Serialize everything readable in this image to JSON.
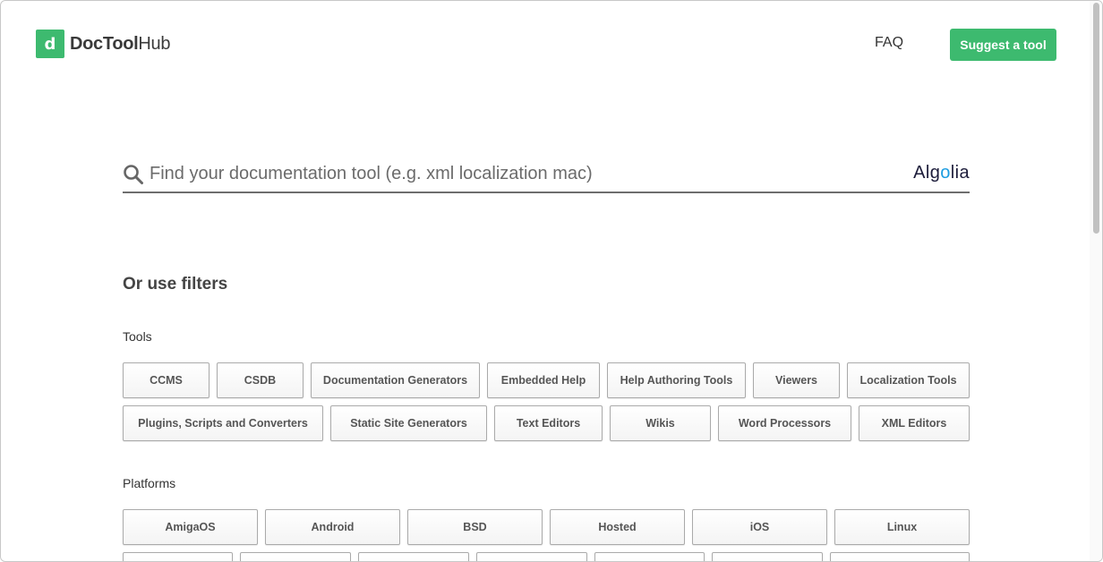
{
  "header": {
    "logo_letter": "d",
    "logo_bold": "DocTool",
    "logo_light": "Hub",
    "faq_label": "FAQ",
    "suggest_label": "Suggest a tool"
  },
  "search": {
    "placeholder": "Find your documentation tool (e.g. xml localization mac)",
    "brand_prefix": "Alg",
    "brand_o": "o",
    "brand_suffix": "lia"
  },
  "filters": {
    "title": "Or use filters",
    "tools": {
      "label": "Tools",
      "items": [
        "CCMS",
        "CSDB",
        "Documentation Generators",
        "Embedded Help",
        "Help Authoring Tools",
        "Viewers",
        "Localization Tools",
        "Plugins, Scripts and Converters",
        "Static Site Generators",
        "Text Editors",
        "Wikis",
        "Word Processors",
        "XML Editors"
      ]
    },
    "platforms": {
      "label": "Platforms",
      "items": [
        "AmigaOS",
        "Android",
        "BSD",
        "Hosted",
        "iOS",
        "Linux"
      ]
    }
  },
  "colors": {
    "brand_green": "#3dba6f",
    "algolia_accent": "#1b9ce0"
  }
}
